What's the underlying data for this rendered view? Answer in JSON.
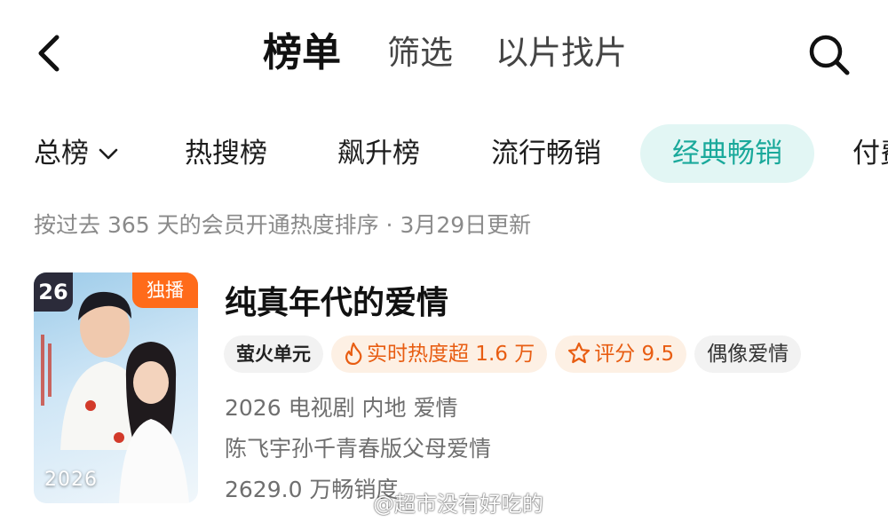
{
  "nav": {
    "tabs": [
      {
        "label": "榜单",
        "active": true
      },
      {
        "label": "筛选",
        "active": false
      },
      {
        "label": "以片找片",
        "active": false
      }
    ]
  },
  "categories": [
    {
      "label": "总榜",
      "active": false,
      "has_dropdown": true
    },
    {
      "label": "热搜榜",
      "active": false
    },
    {
      "label": "飙升榜",
      "active": false
    },
    {
      "label": "流行畅销",
      "active": false
    },
    {
      "label": "经典畅销",
      "active": true
    },
    {
      "label": "付费",
      "active": false
    }
  ],
  "description": "按过去 365 天的会员开通热度排序 · 3月29日更新",
  "item": {
    "rank": "26",
    "exclusive_badge": "独播",
    "poster_year": "2026",
    "title": "纯真年代的爱情",
    "tags": {
      "brand": "萤火单元",
      "hot": "实时热度超 1.6 万",
      "score": "评分 9.5",
      "genre": "偶像爱情"
    },
    "meta_line1": "2026 电视剧 内地 爱情",
    "meta_line2": "陈飞宇孙千青春版父母爱情",
    "meta_line3": "2629.0 万畅销度"
  },
  "watermark": "@超市没有好吃的",
  "colors": {
    "accent": "#1aa99b",
    "accent_bg": "#e2f6f4",
    "orange": "#e85d12",
    "exclusive": "#ff6b1a"
  }
}
